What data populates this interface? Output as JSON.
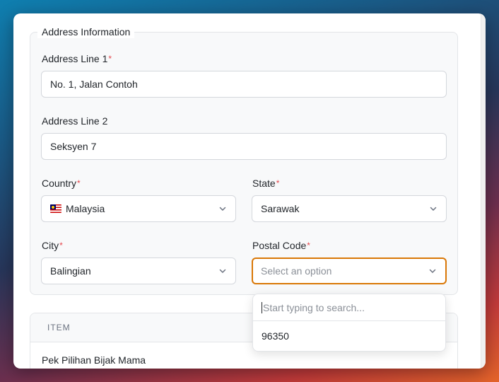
{
  "form": {
    "section_title": "Address Information",
    "required_marker": "*",
    "address_line1": {
      "label": "Address Line 1",
      "value": "No. 1, Jalan Contoh"
    },
    "address_line2": {
      "label": "Address Line 2",
      "value": "Seksyen 7"
    },
    "country": {
      "label": "Country",
      "value": "Malaysia",
      "flag_icon": "malaysia-flag-icon"
    },
    "state": {
      "label": "State",
      "value": "Sarawak"
    },
    "city": {
      "label": "City",
      "value": "Balingian"
    },
    "postal_code": {
      "label": "Postal Code",
      "placeholder": "Select an option"
    }
  },
  "postal_dropdown": {
    "search_placeholder": "Start typing to search...",
    "options": [
      "96350"
    ]
  },
  "items_table": {
    "header": "ITEM",
    "rows": [
      "Pek Pilihan Bijak Mama"
    ]
  },
  "colors": {
    "focus_border": "#d97706",
    "required": "#e5484d"
  }
}
